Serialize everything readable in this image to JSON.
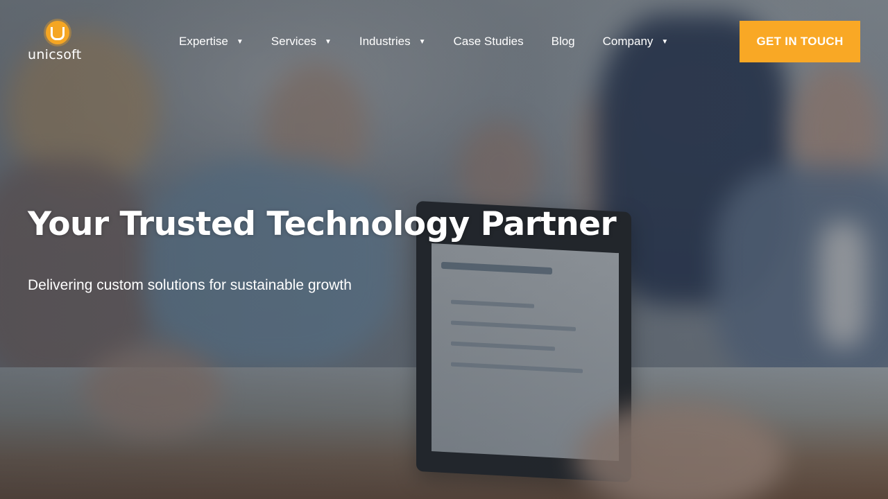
{
  "brand": {
    "logo_letter": "U",
    "logo_text": "unicsoft",
    "accent_color": "#f9a825"
  },
  "nav": {
    "items": [
      {
        "label": "Expertise",
        "has_dropdown": true
      },
      {
        "label": "Services",
        "has_dropdown": true
      },
      {
        "label": "Industries",
        "has_dropdown": true
      },
      {
        "label": "Case Studies",
        "has_dropdown": false
      },
      {
        "label": "Blog",
        "has_dropdown": false
      },
      {
        "label": "Company",
        "has_dropdown": true
      }
    ],
    "dropdown_glyph": "▼"
  },
  "cta": {
    "label": "GET IN TOUCH"
  },
  "hero": {
    "title": "Your Trusted Technology Partner",
    "subtitle": "Delivering custom solutions for sustainable growth",
    "background": "team-working-at-laptop-photo"
  }
}
